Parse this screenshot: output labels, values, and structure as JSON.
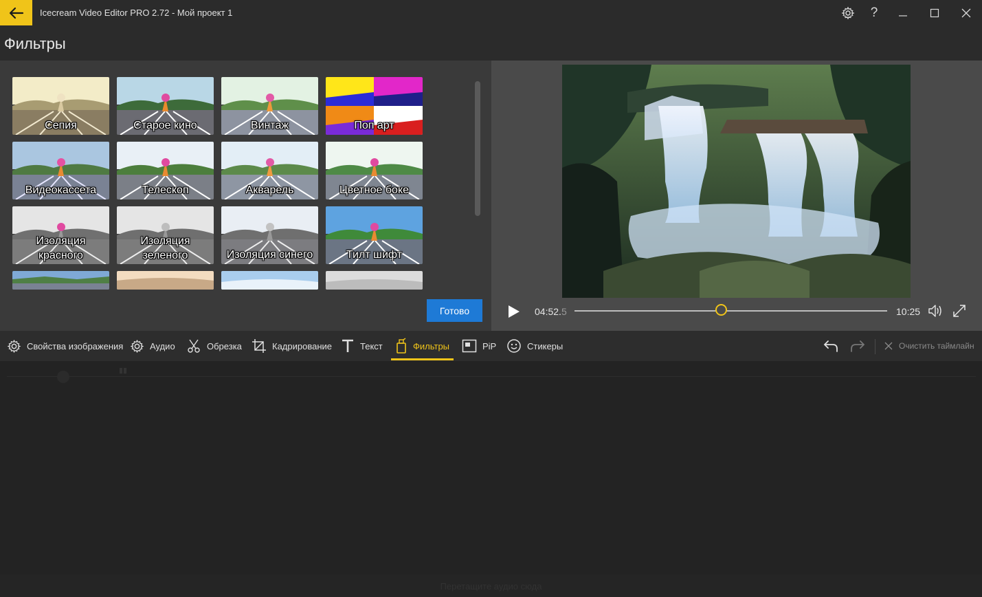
{
  "titlebar": {
    "title": "Icecream Video Editor PRO 2.72  -  Мой проект 1",
    "back_icon": "arrow-left-icon",
    "accent": "#f0c419",
    "icons": [
      "gear-icon",
      "help-icon",
      "minimize-icon",
      "maximize-icon",
      "close-icon"
    ],
    "help_label": "?"
  },
  "page": {
    "title": "Фильтры"
  },
  "filters": [
    {
      "label": "Сепия"
    },
    {
      "label": "Старое кино"
    },
    {
      "label": "Винтаж"
    },
    {
      "label": "Поп арт"
    },
    {
      "label": "Видеокассета"
    },
    {
      "label": "Телескоп"
    },
    {
      "label": "Акварель"
    },
    {
      "label": "Цветное боке"
    },
    {
      "label": "Изоляция красного"
    },
    {
      "label": "Изоляция зеленого"
    },
    {
      "label": "Изоляция синего"
    },
    {
      "label": "Тилт шифт"
    }
  ],
  "done_button": "Готово",
  "done_color": "#1e7ad6",
  "player": {
    "current_time_main": "04:52.",
    "current_time_frac": "5",
    "total_time": "10:25",
    "progress": 0.47
  },
  "toolbar": {
    "items": [
      {
        "label": "Свойства изображения",
        "icon": "gear-icon"
      },
      {
        "label": "Аудио",
        "icon": "gear-icon"
      },
      {
        "label": "Обрезка",
        "icon": "scissors-icon"
      },
      {
        "label": "Кадрирование",
        "icon": "crop-icon"
      },
      {
        "label": "Текст",
        "icon": "text-icon"
      },
      {
        "label": "Фильтры",
        "icon": "filter-bottle-icon",
        "active": true
      },
      {
        "label": "PiP",
        "icon": "pip-icon"
      },
      {
        "label": "Стикеры",
        "icon": "smiley-icon"
      }
    ],
    "undo_icon": "undo-icon",
    "redo_icon": "redo-icon",
    "clear_label": "Очистить таймлайн"
  },
  "timeline": {
    "hint": "Перетащите аудио сюда"
  }
}
